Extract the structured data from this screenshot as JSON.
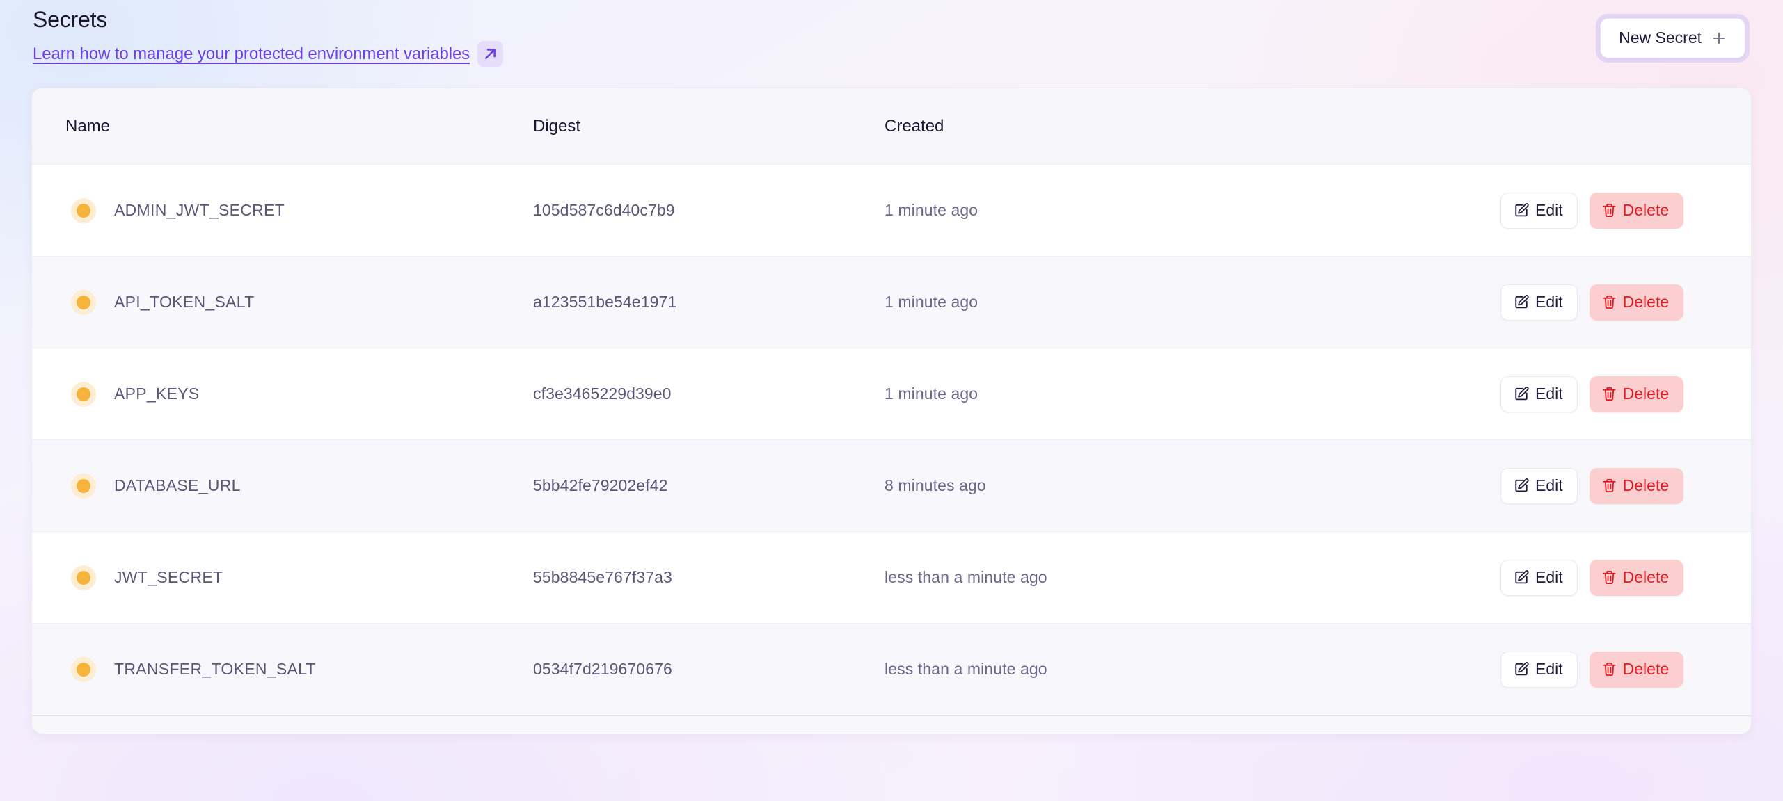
{
  "header": {
    "title": "Secrets",
    "doc_link_text": "Learn how to manage your protected environment variables",
    "ext_link_icon": "external-link-arrow-icon",
    "new_secret_label": "New Secret",
    "plus_icon": "plus-icon"
  },
  "table": {
    "columns": [
      "Name",
      "Digest",
      "Created"
    ],
    "actions": {
      "edit_label": "Edit",
      "edit_icon": "pencil-square-edit-icon",
      "delete_label": "Delete",
      "delete_icon": "trash-can-icon"
    },
    "rows": [
      {
        "status": "active",
        "name": "ADMIN_JWT_SECRET",
        "digest": "105d587c6d40c7b9",
        "created": "1 minute ago"
      },
      {
        "status": "active",
        "name": "API_TOKEN_SALT",
        "digest": "a123551be54e1971",
        "created": "1 minute ago"
      },
      {
        "status": "active",
        "name": "APP_KEYS",
        "digest": "cf3e3465229d39e0",
        "created": "1 minute ago"
      },
      {
        "status": "active",
        "name": "DATABASE_URL",
        "digest": "5bb42fe79202ef42",
        "created": "8 minutes ago"
      },
      {
        "status": "active",
        "name": "JWT_SECRET",
        "digest": "55b8845e767f37a3",
        "created": "less than a minute ago"
      },
      {
        "status": "active",
        "name": "TRANSFER_TOKEN_SALT",
        "digest": "0534f7d219670676",
        "created": "less than a minute ago"
      }
    ]
  },
  "colors": {
    "accent_purple": "#6d3fe8",
    "status_dot": "#f7b43c",
    "status_dot_halo": "#fdeed3",
    "delete_bg": "#fbcfcf",
    "delete_text": "#e01b24",
    "text_primary": "#1b1632",
    "text_secondary": "#5b5778"
  }
}
